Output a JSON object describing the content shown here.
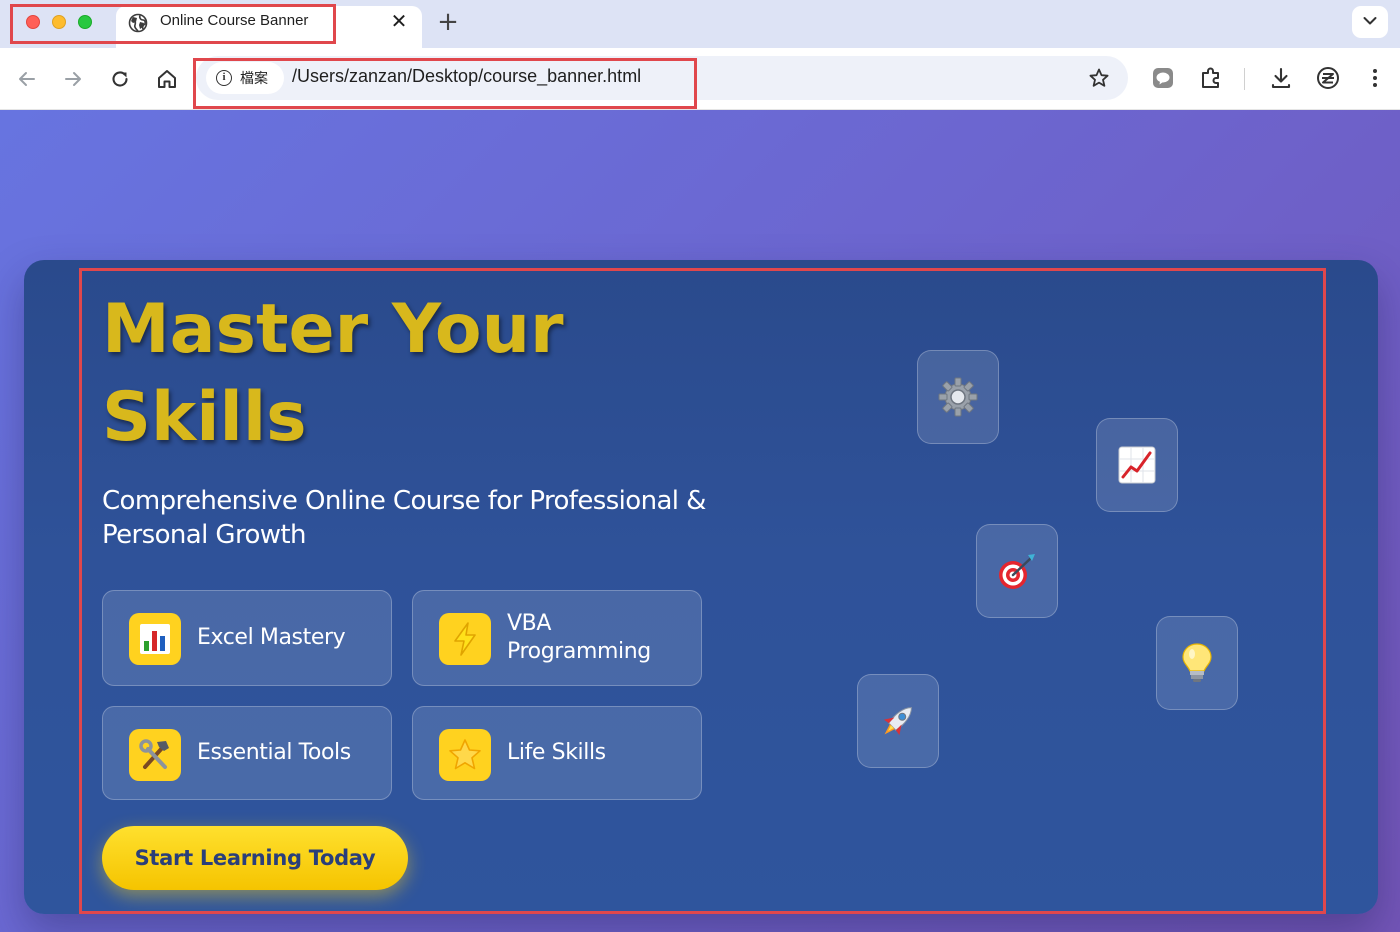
{
  "browser": {
    "tab_title": "Online Course Banner",
    "tab_close": "✕",
    "new_tab": "+",
    "chip_label": "檔案",
    "chip_info": "i",
    "url": "/Users/zanzan/Desktop/course_banner.html"
  },
  "banner": {
    "headline": "Master Your Skills",
    "subtitle": "Comprehensive Online Course for Professional & Personal Growth",
    "features": [
      {
        "label": "Excel Mastery",
        "icon": "bar-chart-icon"
      },
      {
        "label": "VBA Programming",
        "icon": "lightning-icon"
      },
      {
        "label": "Essential Tools",
        "icon": "hammer-wrench-icon"
      },
      {
        "label": "Life Skills",
        "icon": "star-icon"
      }
    ],
    "cta_label": "Start Learning Today",
    "floating_icons": [
      "gear-icon",
      "chart-increasing-icon",
      "target-icon",
      "lightbulb-icon",
      "rocket-icon"
    ]
  },
  "colors": {
    "headline": "#d8b81c",
    "accent_yellow": "#ffd21f",
    "banner_bg": "#2f5299",
    "page_bg": "#6d63cc",
    "highlight_border": "#e0474c"
  }
}
